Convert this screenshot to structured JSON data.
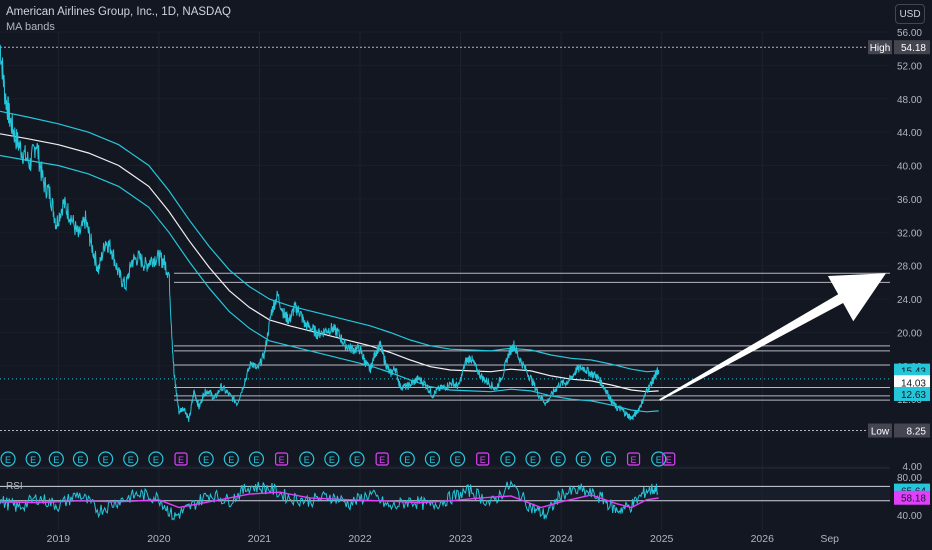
{
  "header": {
    "title": "American Airlines Group, Inc., 1D, NASDAQ",
    "indicator": "MA bands",
    "currency": "USD"
  },
  "chart_data": {
    "type": "line",
    "y_axis": {
      "ticks": [
        "56.00",
        "52.00",
        "48.00",
        "44.00",
        "40.00",
        "36.00",
        "32.00",
        "28.00",
        "24.00",
        "20.00",
        "16.00",
        "12.00",
        "8.00",
        "4.00"
      ],
      "range": [
        4,
        56
      ]
    },
    "x_axis": {
      "ticks": [
        "2019",
        "2020",
        "2021",
        "2022",
        "2023",
        "2024",
        "2025",
        "2026",
        "Sep"
      ],
      "range": [
        2018.42,
        2027.27
      ]
    },
    "price_series": {
      "color": "#26c6da",
      "points": [
        [
          2018.42,
          54.5
        ],
        [
          2018.47,
          48.5
        ],
        [
          2018.52,
          45.5
        ],
        [
          2018.58,
          43.2
        ],
        [
          2018.65,
          41.5
        ],
        [
          2018.72,
          40.2
        ],
        [
          2018.78,
          42.8
        ],
        [
          2018.85,
          38.0
        ],
        [
          2018.92,
          36.5
        ],
        [
          2018.98,
          33.0
        ],
        [
          2019.05,
          35.5
        ],
        [
          2019.12,
          34.0
        ],
        [
          2019.2,
          31.5
        ],
        [
          2019.27,
          33.5
        ],
        [
          2019.33,
          30.5
        ],
        [
          2019.4,
          27.5
        ],
        [
          2019.47,
          31.0
        ],
        [
          2019.53,
          30.0
        ],
        [
          2019.6,
          27.0
        ],
        [
          2019.67,
          25.5
        ],
        [
          2019.73,
          28.5
        ],
        [
          2019.8,
          29.0
        ],
        [
          2019.87,
          28.0
        ],
        [
          2019.93,
          28.8
        ],
        [
          2020.0,
          29.0
        ],
        [
          2020.05,
          28.5
        ],
        [
          2020.1,
          27.0
        ],
        [
          2020.15,
          15.0
        ],
        [
          2020.2,
          10.5
        ],
        [
          2020.25,
          11.0
        ],
        [
          2020.3,
          9.5
        ],
        [
          2020.35,
          13.0
        ],
        [
          2020.4,
          11.0
        ],
        [
          2020.45,
          12.8
        ],
        [
          2020.5,
          13.0
        ],
        [
          2020.55,
          12.0
        ],
        [
          2020.62,
          13.5
        ],
        [
          2020.7,
          12.5
        ],
        [
          2020.78,
          11.5
        ],
        [
          2020.85,
          14.0
        ],
        [
          2020.92,
          16.5
        ],
        [
          2020.98,
          15.5
        ],
        [
          2021.05,
          17.5
        ],
        [
          2021.12,
          22.5
        ],
        [
          2021.18,
          24.5
        ],
        [
          2021.25,
          22.0
        ],
        [
          2021.3,
          21.5
        ],
        [
          2021.35,
          23.0
        ],
        [
          2021.4,
          22.5
        ],
        [
          2021.45,
          21.0
        ],
        [
          2021.52,
          20.5
        ],
        [
          2021.58,
          19.8
        ],
        [
          2021.65,
          20.2
        ],
        [
          2021.72,
          20.5
        ],
        [
          2021.78,
          20.0
        ],
        [
          2021.85,
          18.5
        ],
        [
          2021.92,
          18.0
        ],
        [
          2022.0,
          18.0
        ],
        [
          2022.05,
          16.5
        ],
        [
          2022.1,
          15.5
        ],
        [
          2022.15,
          17.5
        ],
        [
          2022.2,
          18.5
        ],
        [
          2022.25,
          16.5
        ],
        [
          2022.3,
          15.0
        ],
        [
          2022.35,
          15.8
        ],
        [
          2022.4,
          13.5
        ],
        [
          2022.47,
          13.5
        ],
        [
          2022.53,
          14.0
        ],
        [
          2022.58,
          14.5
        ],
        [
          2022.65,
          13.8
        ],
        [
          2022.72,
          12.5
        ],
        [
          2022.78,
          13.2
        ],
        [
          2022.85,
          13.5
        ],
        [
          2022.92,
          14.0
        ],
        [
          2022.98,
          13.5
        ],
        [
          2023.05,
          16.5
        ],
        [
          2023.1,
          17.0
        ],
        [
          2023.15,
          15.8
        ],
        [
          2023.22,
          14.5
        ],
        [
          2023.28,
          14.0
        ],
        [
          2023.35,
          13.2
        ],
        [
          2023.42,
          15.0
        ],
        [
          2023.48,
          17.5
        ],
        [
          2023.53,
          18.5
        ],
        [
          2023.58,
          17.0
        ],
        [
          2023.65,
          15.5
        ],
        [
          2023.72,
          14.0
        ],
        [
          2023.78,
          12.5
        ],
        [
          2023.85,
          11.5
        ],
        [
          2023.92,
          12.8
        ],
        [
          2023.98,
          13.8
        ],
        [
          2024.05,
          14.0
        ],
        [
          2024.1,
          14.5
        ],
        [
          2024.15,
          15.5
        ],
        [
          2024.22,
          15.8
        ],
        [
          2024.28,
          15.2
        ],
        [
          2024.35,
          14.8
        ],
        [
          2024.4,
          14.0
        ],
        [
          2024.45,
          13.0
        ],
        [
          2024.5,
          11.8
        ],
        [
          2024.55,
          11.0
        ],
        [
          2024.6,
          10.8
        ],
        [
          2024.65,
          10.2
        ],
        [
          2024.7,
          9.7
        ],
        [
          2024.75,
          10.4
        ],
        [
          2024.8,
          11.5
        ],
        [
          2024.85,
          13.0
        ],
        [
          2024.9,
          14.0
        ],
        [
          2024.93,
          14.6
        ],
        [
          2024.95,
          15.2
        ],
        [
          2024.97,
          15.5
        ]
      ]
    },
    "ma_series": {
      "name": "MA bands",
      "color": "#f0f0f0",
      "points": [
        [
          2018.42,
          43.8
        ],
        [
          2018.7,
          43.2
        ],
        [
          2019.0,
          42.5
        ],
        [
          2019.3,
          41.5
        ],
        [
          2019.6,
          40.0
        ],
        [
          2019.9,
          37.5
        ],
        [
          2020.1,
          34.5
        ],
        [
          2020.3,
          31.0
        ],
        [
          2020.5,
          27.8
        ],
        [
          2020.7,
          25.0
        ],
        [
          2020.9,
          23.0
        ],
        [
          2021.1,
          21.5
        ],
        [
          2021.3,
          20.8
        ],
        [
          2021.5,
          20.2
        ],
        [
          2021.7,
          19.6
        ],
        [
          2021.9,
          19.0
        ],
        [
          2022.1,
          18.4
        ],
        [
          2022.3,
          17.6
        ],
        [
          2022.5,
          16.7
        ],
        [
          2022.7,
          15.9
        ],
        [
          2022.9,
          15.5
        ],
        [
          2023.1,
          15.4
        ],
        [
          2023.3,
          15.3
        ],
        [
          2023.5,
          15.6
        ],
        [
          2023.7,
          15.4
        ],
        [
          2023.9,
          14.8
        ],
        [
          2024.1,
          14.4
        ],
        [
          2024.3,
          14.2
        ],
        [
          2024.5,
          13.7
        ],
        [
          2024.7,
          13.1
        ],
        [
          2024.85,
          12.9
        ],
        [
          2024.97,
          13.0
        ]
      ]
    },
    "upper_band": {
      "color": "#26c6da",
      "points": [
        [
          2018.42,
          46.5
        ],
        [
          2018.7,
          45.8
        ],
        [
          2019.0,
          45.0
        ],
        [
          2019.3,
          44.0
        ],
        [
          2019.6,
          42.5
        ],
        [
          2019.9,
          40.0
        ],
        [
          2020.1,
          37.0
        ],
        [
          2020.3,
          33.5
        ],
        [
          2020.5,
          30.3
        ],
        [
          2020.7,
          27.5
        ],
        [
          2020.9,
          25.5
        ],
        [
          2021.1,
          24.0
        ],
        [
          2021.3,
          23.2
        ],
        [
          2021.5,
          22.6
        ],
        [
          2021.7,
          22.0
        ],
        [
          2021.9,
          21.4
        ],
        [
          2022.1,
          20.8
        ],
        [
          2022.3,
          20.0
        ],
        [
          2022.5,
          19.1
        ],
        [
          2022.7,
          18.4
        ],
        [
          2022.9,
          18.0
        ],
        [
          2023.1,
          17.9
        ],
        [
          2023.3,
          17.8
        ],
        [
          2023.5,
          18.1
        ],
        [
          2023.7,
          17.9
        ],
        [
          2023.9,
          17.3
        ],
        [
          2024.1,
          16.9
        ],
        [
          2024.3,
          16.7
        ],
        [
          2024.5,
          16.2
        ],
        [
          2024.7,
          15.6
        ],
        [
          2024.85,
          15.3
        ],
        [
          2024.97,
          15.4
        ]
      ]
    },
    "lower_band": {
      "color": "#26c6da",
      "points": [
        [
          2018.42,
          41.2
        ],
        [
          2018.7,
          40.6
        ],
        [
          2019.0,
          40.0
        ],
        [
          2019.3,
          39.0
        ],
        [
          2019.6,
          37.5
        ],
        [
          2019.9,
          35.0
        ],
        [
          2020.1,
          32.0
        ],
        [
          2020.3,
          28.5
        ],
        [
          2020.5,
          25.3
        ],
        [
          2020.7,
          22.5
        ],
        [
          2020.9,
          20.5
        ],
        [
          2021.1,
          19.0
        ],
        [
          2021.3,
          18.4
        ],
        [
          2021.5,
          17.8
        ],
        [
          2021.7,
          17.2
        ],
        [
          2021.9,
          16.6
        ],
        [
          2022.1,
          16.0
        ],
        [
          2022.3,
          15.2
        ],
        [
          2022.5,
          14.3
        ],
        [
          2022.7,
          13.5
        ],
        [
          2022.9,
          13.1
        ],
        [
          2023.1,
          13.0
        ],
        [
          2023.3,
          12.9
        ],
        [
          2023.5,
          13.2
        ],
        [
          2023.7,
          13.0
        ],
        [
          2023.9,
          12.4
        ],
        [
          2024.1,
          12.0
        ],
        [
          2024.3,
          11.8
        ],
        [
          2024.5,
          11.3
        ],
        [
          2024.7,
          10.7
        ],
        [
          2024.85,
          10.5
        ],
        [
          2024.97,
          10.6
        ]
      ]
    },
    "horizontal_levels": [
      {
        "y": 27.1,
        "color": "#d1d4dc"
      },
      {
        "y": 26.0,
        "color": "#d1d4dc"
      },
      {
        "y": 18.4,
        "color": "#d1d4dc"
      },
      {
        "y": 17.8,
        "color": "#d1d4dc"
      },
      {
        "y": 16.1,
        "color": "#d1d4dc"
      },
      {
        "y": 13.4,
        "color": "#d1d4dc"
      },
      {
        "y": 12.4,
        "color": "#d1d4dc"
      },
      {
        "y": 11.9,
        "color": "#d1d4dc"
      }
    ],
    "price_labels": [
      {
        "text": "High",
        "value": "54.18",
        "y": 54.18,
        "kind": "high"
      },
      {
        "text": "",
        "value": "15.43",
        "y": 15.43,
        "kind": "cyan"
      },
      {
        "text": "",
        "value": "14.44",
        "y": 14.44,
        "kind": "cyan"
      },
      {
        "text": "",
        "value": "14.03",
        "y": 14.03,
        "kind": "white"
      },
      {
        "text": "",
        "value": "12.63",
        "y": 12.63,
        "kind": "cyan"
      },
      {
        "text": "Low",
        "value": "8.25",
        "y": 8.25,
        "kind": "low"
      }
    ],
    "high_line": 54.18,
    "low_line": 8.25,
    "current_price": 14.44,
    "arrow": {
      "from": [
        2024.98,
        11.9
      ],
      "to": [
        2027.23,
        27.1
      ],
      "color": "#ffffff"
    },
    "earnings_markers": {
      "label": "E",
      "dates": [
        2018.5,
        2018.75,
        2018.98,
        2019.22,
        2019.47,
        2019.72,
        2019.97,
        2020.22,
        2020.47,
        2020.72,
        2020.97,
        2021.22,
        2021.47,
        2021.72,
        2021.97,
        2022.22,
        2022.47,
        2022.72,
        2022.97,
        2023.22,
        2023.47,
        2023.72,
        2023.97,
        2024.22,
        2024.47,
        2024.72,
        2024.97,
        2025.07
      ],
      "highlighted": [
        7,
        11,
        15,
        19,
        25,
        27
      ],
      "color": "#26c6da",
      "highlight_color": "#e040fb"
    },
    "rsi": {
      "label": "RSI",
      "axis_ticks": [
        "80.00",
        "40.00"
      ],
      "range": [
        35,
        85
      ],
      "upper_band": 70,
      "lower_band": 55,
      "labels": [
        {
          "value": "65.64",
          "y": 65.64,
          "color": "#26c6da"
        },
        {
          "value": "58.18",
          "y": 58.18,
          "color": "#e040fb"
        }
      ],
      "rsi_color": "#26c6da",
      "ma_color": "#e040fb",
      "rsi_points": [
        [
          2018.42,
          55
        ],
        [
          2018.6,
          48
        ],
        [
          2018.8,
          58
        ],
        [
          2019.0,
          50
        ],
        [
          2019.2,
          62
        ],
        [
          2019.4,
          45
        ],
        [
          2019.6,
          55
        ],
        [
          2019.8,
          62
        ],
        [
          2020.0,
          58
        ],
        [
          2020.15,
          38
        ],
        [
          2020.3,
          48
        ],
        [
          2020.5,
          62
        ],
        [
          2020.7,
          55
        ],
        [
          2020.9,
          70
        ],
        [
          2021.1,
          68
        ],
        [
          2021.3,
          58
        ],
        [
          2021.5,
          55
        ],
        [
          2021.7,
          60
        ],
        [
          2021.9,
          52
        ],
        [
          2022.1,
          62
        ],
        [
          2022.3,
          48
        ],
        [
          2022.5,
          55
        ],
        [
          2022.7,
          50
        ],
        [
          2022.9,
          58
        ],
        [
          2023.1,
          66
        ],
        [
          2023.3,
          52
        ],
        [
          2023.5,
          72
        ],
        [
          2023.7,
          48
        ],
        [
          2023.85,
          40
        ],
        [
          2024.0,
          62
        ],
        [
          2024.2,
          66
        ],
        [
          2024.4,
          58
        ],
        [
          2024.55,
          45
        ],
        [
          2024.7,
          50
        ],
        [
          2024.85,
          66
        ],
        [
          2024.97,
          68
        ]
      ],
      "ma_points": [
        [
          2018.42,
          54
        ],
        [
          2018.8,
          53
        ],
        [
          2019.2,
          55
        ],
        [
          2019.6,
          54
        ],
        [
          2020.0,
          56
        ],
        [
          2020.2,
          48
        ],
        [
          2020.5,
          54
        ],
        [
          2020.9,
          62
        ],
        [
          2021.2,
          64
        ],
        [
          2021.5,
          58
        ],
        [
          2021.9,
          56
        ],
        [
          2022.2,
          55
        ],
        [
          2022.6,
          53
        ],
        [
          2022.9,
          55
        ],
        [
          2023.2,
          58
        ],
        [
          2023.5,
          60
        ],
        [
          2023.8,
          48
        ],
        [
          2024.0,
          54
        ],
        [
          2024.3,
          61
        ],
        [
          2024.55,
          52
        ],
        [
          2024.7,
          48
        ],
        [
          2024.85,
          56
        ],
        [
          2024.97,
          58
        ]
      ]
    }
  }
}
